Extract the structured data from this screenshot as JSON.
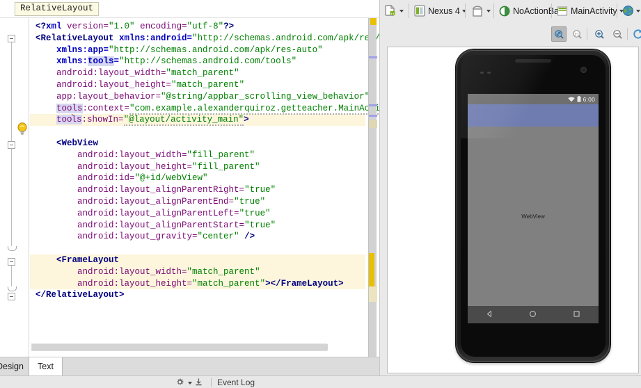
{
  "editor": {
    "breadcrumb": "RelativeLayout",
    "lines": [
      {
        "id": "l1",
        "highlight": false,
        "indent": 0,
        "segments": [
          {
            "t": "<?",
            "c": "pi"
          },
          {
            "t": "xml",
            "c": "ns"
          },
          {
            "t": " version=",
            "c": "at"
          },
          {
            "t": "\"1.0\"",
            "c": "v"
          },
          {
            "t": " encoding=",
            "c": "at"
          },
          {
            "t": "\"utf-8\"",
            "c": "v"
          },
          {
            "t": "?>",
            "c": "pi"
          }
        ]
      },
      {
        "id": "l2",
        "highlight": false,
        "indent": 0,
        "segments": [
          {
            "t": "<RelativeLayout ",
            "c": "k"
          },
          {
            "t": "xmlns:android=",
            "c": "ns"
          },
          {
            "t": "\"http://schemas.android.com/apk/res/android\"",
            "c": "v"
          }
        ]
      },
      {
        "id": "l3",
        "highlight": false,
        "indent": 4,
        "segments": [
          {
            "t": "xmlns:app=",
            "c": "ns"
          },
          {
            "t": "\"http://schemas.android.com/apk/res-auto\"",
            "c": "v"
          }
        ]
      },
      {
        "id": "l4",
        "highlight": false,
        "indent": 4,
        "segments": [
          {
            "t": "xmlns:",
            "c": "ns"
          },
          {
            "t": "tools",
            "c": "sel-ns"
          },
          {
            "t": "=",
            "c": "ns"
          },
          {
            "t": "\"http://schemas.android.com/tools\"",
            "c": "v"
          }
        ]
      },
      {
        "id": "l5",
        "highlight": false,
        "indent": 4,
        "segments": [
          {
            "t": "android:layout_width=",
            "c": "at"
          },
          {
            "t": "\"match_parent\"",
            "c": "v"
          }
        ]
      },
      {
        "id": "l6",
        "highlight": false,
        "indent": 4,
        "segments": [
          {
            "t": "android:layout_height=",
            "c": "at"
          },
          {
            "t": "\"match_parent\"",
            "c": "v"
          }
        ]
      },
      {
        "id": "l7",
        "highlight": false,
        "indent": 4,
        "segments": [
          {
            "t": "app:layout_behavior=",
            "c": "at"
          },
          {
            "t": "\"@string/appbar_scrolling_view_behavior\"",
            "c": "v"
          }
        ]
      },
      {
        "id": "l8",
        "highlight": false,
        "indent": 4,
        "segments": [
          {
            "t": "tools",
            "c": "sel-at"
          },
          {
            "t": ":context=",
            "c": "at"
          },
          {
            "t": "\"com.example.alexanderquiroz.getteacher.MainActivity\"",
            "c": "v-squig"
          }
        ]
      },
      {
        "id": "l9",
        "highlight": true,
        "indent": 4,
        "segments": [
          {
            "t": "too",
            "c": "sel-at"
          },
          {
            "t": "|",
            "c": "caret"
          },
          {
            "t": "ls",
            "c": "sel-at"
          },
          {
            "t": ":showIn=",
            "c": "at"
          },
          {
            "t": "\"@layout/activity_main\"",
            "c": "v-squig"
          },
          {
            "t": ">",
            "c": "k"
          }
        ]
      },
      {
        "id": "l10",
        "highlight": false,
        "indent": 0,
        "segments": []
      },
      {
        "id": "l11",
        "highlight": false,
        "indent": 4,
        "segments": [
          {
            "t": "<WebView",
            "c": "k"
          }
        ]
      },
      {
        "id": "l12",
        "highlight": false,
        "indent": 8,
        "segments": [
          {
            "t": "android:layout_width=",
            "c": "at"
          },
          {
            "t": "\"fill_parent\"",
            "c": "v"
          }
        ]
      },
      {
        "id": "l13",
        "highlight": false,
        "indent": 8,
        "segments": [
          {
            "t": "android:layout_height=",
            "c": "at"
          },
          {
            "t": "\"fill_parent\"",
            "c": "v"
          }
        ]
      },
      {
        "id": "l14",
        "highlight": false,
        "indent": 8,
        "segments": [
          {
            "t": "android:id=",
            "c": "at"
          },
          {
            "t": "\"@+id/webView\"",
            "c": "v"
          }
        ]
      },
      {
        "id": "l15",
        "highlight": false,
        "indent": 8,
        "segments": [
          {
            "t": "android:layout_alignParentRight=",
            "c": "at"
          },
          {
            "t": "\"true\"",
            "c": "v"
          }
        ]
      },
      {
        "id": "l16",
        "highlight": false,
        "indent": 8,
        "segments": [
          {
            "t": "android:layout_alignParentEnd=",
            "c": "at"
          },
          {
            "t": "\"true\"",
            "c": "v"
          }
        ]
      },
      {
        "id": "l17",
        "highlight": false,
        "indent": 8,
        "segments": [
          {
            "t": "android:layout_alignParentLeft=",
            "c": "at"
          },
          {
            "t": "\"true\"",
            "c": "v"
          }
        ]
      },
      {
        "id": "l18",
        "highlight": false,
        "indent": 8,
        "segments": [
          {
            "t": "android:layout_alignParentStart=",
            "c": "at"
          },
          {
            "t": "\"true\"",
            "c": "v"
          }
        ]
      },
      {
        "id": "l19",
        "highlight": false,
        "indent": 8,
        "segments": [
          {
            "t": "android:layout_gravity=",
            "c": "at"
          },
          {
            "t": "\"center\"",
            "c": "v"
          },
          {
            "t": " />",
            "c": "k"
          }
        ]
      },
      {
        "id": "l20",
        "highlight": false,
        "indent": 0,
        "segments": []
      },
      {
        "id": "l21",
        "highlight": true,
        "indent": 4,
        "segments": [
          {
            "t": "<FrameLayout",
            "c": "k"
          }
        ]
      },
      {
        "id": "l22",
        "highlight": true,
        "indent": 8,
        "segments": [
          {
            "t": "android:layout_width=",
            "c": "at"
          },
          {
            "t": "\"match_parent\"",
            "c": "v"
          }
        ]
      },
      {
        "id": "l23",
        "highlight": true,
        "indent": 8,
        "segments": [
          {
            "t": "android:layout_height=",
            "c": "at"
          },
          {
            "t": "\"match_parent\"",
            "c": "v"
          },
          {
            "t": "></FrameLayout>",
            "c": "k"
          }
        ]
      },
      {
        "id": "l24",
        "highlight": false,
        "indent": 0,
        "segments": [
          {
            "t": "</RelativeLayout>",
            "c": "k"
          }
        ]
      }
    ],
    "tabs": [
      {
        "label": "Design",
        "active": false
      },
      {
        "label": "Text",
        "active": true
      }
    ]
  },
  "preview": {
    "toolbar": {
      "file_icon": "android-file-icon",
      "device_label": "Nexus 4",
      "device_icon": "device-icon",
      "orientation_icon": "orientation-icon",
      "theme_label": "NoActionBar",
      "theme_icon": "theme-contrast-icon",
      "activity_label": "MainActivity",
      "activity_icon": "activity-layout-icon",
      "locale_icon": "globe-icon"
    },
    "zoom_toolbar": {
      "fit_icon": "zoom-to-fit-icon",
      "actual_icon": "zoom-actual-size-icon",
      "in_icon": "zoom-in-icon",
      "out_icon": "zoom-out-icon",
      "refresh_icon": "refresh-icon",
      "fit_active": true
    },
    "device_render": {
      "status_time": "6:00",
      "wifi_icon": "wifi-icon",
      "battery_icon": "battery-icon",
      "appbar_color": "#6f7cb0",
      "background_color": "#808080",
      "webview_label": "WebView",
      "nav_back_icon": "nav-back-icon",
      "nav_home_icon": "nav-home-icon",
      "nav_recents_icon": "nav-recents-icon"
    }
  },
  "status_bar": {
    "gear_icon": "settings-gear-icon",
    "hide_icon": "hide-panel-icon",
    "event_log_label": "Event Log"
  },
  "colors": {
    "tag": "#000080",
    "attribute": "#7a0874",
    "value": "#008000",
    "namespace": "#0000c0",
    "highlight_row": "#fdf6dd",
    "appbar": "#6f7cb0"
  }
}
